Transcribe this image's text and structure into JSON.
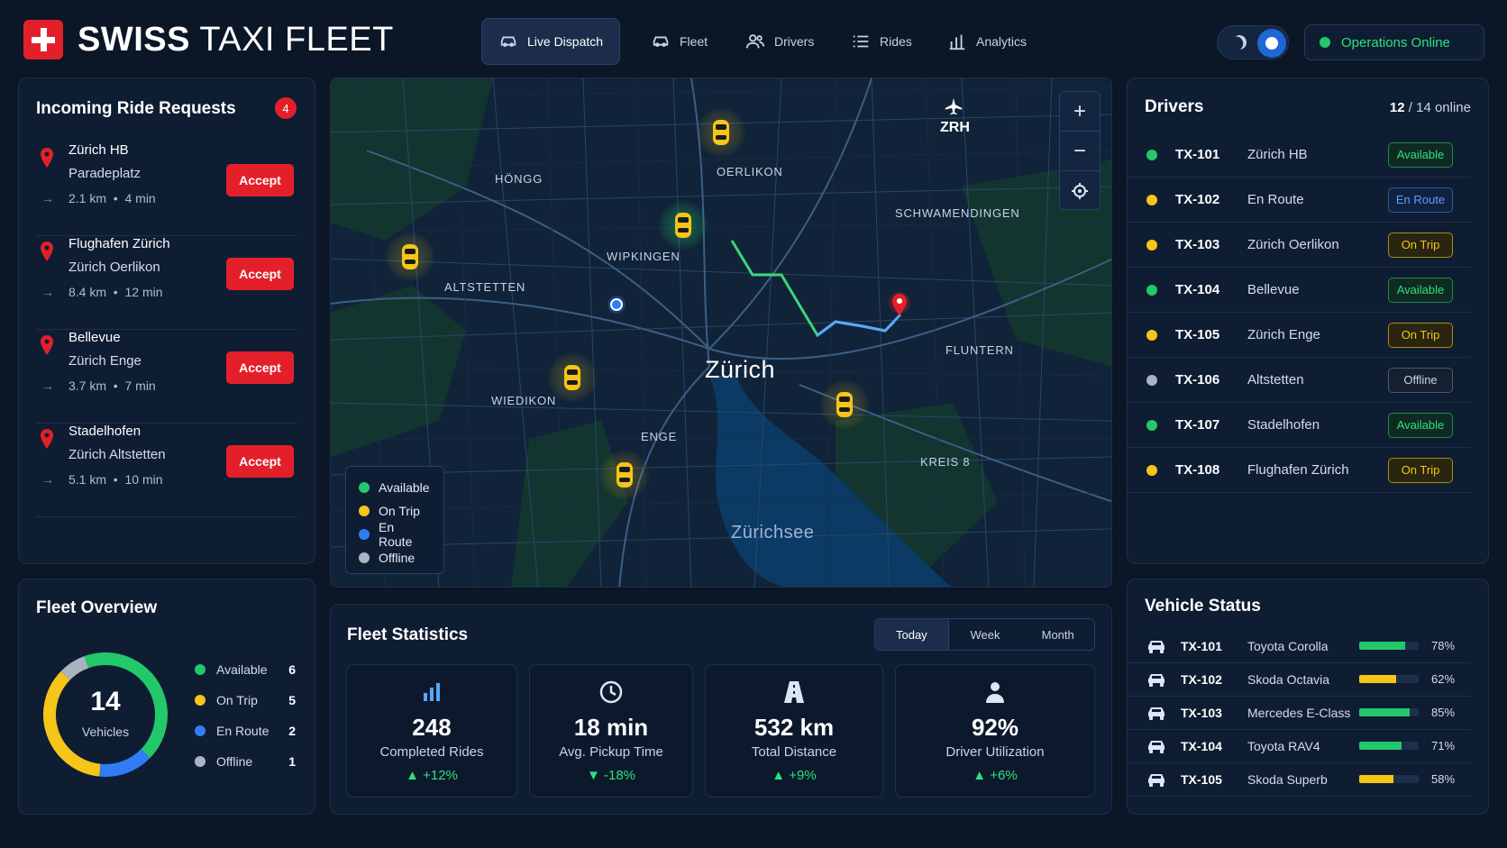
{
  "app": {
    "title_bold": "SWISS",
    "title_rest": "TAXI FLEET"
  },
  "nav": [
    {
      "label": "Live Dispatch",
      "icon": "car-icon"
    },
    {
      "label": "Fleet",
      "icon": "car-icon"
    },
    {
      "label": "Drivers",
      "icon": "users-icon"
    },
    {
      "label": "Rides",
      "icon": "list-icon"
    },
    {
      "label": "Analytics",
      "icon": "bar-chart-icon"
    }
  ],
  "header": {
    "status": "Operations Online",
    "theme": "dark"
  },
  "requests": {
    "title": "Incoming Ride Requests",
    "count": "4",
    "items": [
      {
        "from": "Zürich HB",
        "to": "Paradeplatz",
        "distance": "2.1 km",
        "eta": "4 min",
        "action": "Accept"
      },
      {
        "from": "Flughafen Zürich",
        "to": "Zürich Oerlikon",
        "distance": "8.4 km",
        "eta": "12 min",
        "action": "Accept"
      },
      {
        "from": "Bellevue",
        "to": "Zürich Enge",
        "distance": "3.7 km",
        "eta": "7 min",
        "action": "Accept"
      },
      {
        "from": "Stadelhofen",
        "to": "Zürich Altstetten",
        "distance": "5.1 km",
        "eta": "10 min",
        "action": "Accept"
      }
    ]
  },
  "overview": {
    "title": "Fleet Overview",
    "total": "14",
    "total_label": "Vehicles",
    "items": [
      {
        "label": "Available",
        "count": "6",
        "color": "#22c86a"
      },
      {
        "label": "On Trip",
        "count": "5",
        "color": "#f5c518"
      },
      {
        "label": "En Route",
        "count": "2",
        "color": "#2f7df6"
      },
      {
        "label": "Offline",
        "count": "1",
        "color": "#a9b3c2"
      }
    ]
  },
  "map": {
    "city": "Zürich",
    "lake": "Zürichsee",
    "airport": "ZRH",
    "districts": [
      "HÖNGG",
      "OERLIKON",
      "SCHWAMENDINGEN",
      "WIPKINGEN",
      "ALTSTETTEN",
      "FLUNTERN",
      "WIEDIKON",
      "ENGE",
      "KREIS 8"
    ],
    "legend": [
      "Available",
      "On Trip",
      "En Route",
      "Offline"
    ],
    "zoom_in": "+",
    "zoom_out": "−"
  },
  "stats": {
    "title": "Fleet Statistics",
    "tabs": [
      "Today",
      "Week",
      "Month"
    ],
    "active_tab": "Today",
    "cards": [
      {
        "value": "248",
        "label": "Completed Rides",
        "delta": "▲ +12%",
        "icon": "bar-chart-icon"
      },
      {
        "value": "18 min",
        "label": "Avg. Pickup Time",
        "delta": "▼ -18%",
        "icon": "clock-icon"
      },
      {
        "value": "532 km",
        "label": "Total Distance",
        "delta": "▲ +9%",
        "icon": "road-icon"
      },
      {
        "value": "92%",
        "label": "Driver Utilization",
        "delta": "▲ +6%",
        "icon": "person-icon"
      }
    ]
  },
  "drivers": {
    "title": "Drivers",
    "online_count": "12",
    "online_total": "/ 14 online",
    "items": [
      {
        "id": "TX-101",
        "location": "Zürich HB",
        "status": "Available"
      },
      {
        "id": "TX-102",
        "location": "En Route",
        "status": "En Route"
      },
      {
        "id": "TX-103",
        "location": "Zürich Oerlikon",
        "status": "On Trip"
      },
      {
        "id": "TX-104",
        "location": "Bellevue",
        "status": "Available"
      },
      {
        "id": "TX-105",
        "location": "Zürich Enge",
        "status": "On Trip"
      },
      {
        "id": "TX-106",
        "location": "Altstetten",
        "status": "Offline"
      },
      {
        "id": "TX-107",
        "location": "Stadelhofen",
        "status": "Available"
      },
      {
        "id": "TX-108",
        "location": "Flughafen Zürich",
        "status": "On Trip"
      }
    ]
  },
  "vehicles": {
    "title": "Vehicle Status",
    "items": [
      {
        "id": "TX-101",
        "model": "Toyota Corolla",
        "level": 78,
        "level_label": "78%",
        "color": "#22c86a"
      },
      {
        "id": "TX-102",
        "model": "Skoda Octavia",
        "level": 62,
        "level_label": "62%",
        "color": "#f5c518"
      },
      {
        "id": "TX-103",
        "model": "Mercedes E-Class",
        "level": 85,
        "level_label": "85%",
        "color": "#22c86a"
      },
      {
        "id": "TX-104",
        "model": "Toyota RAV4",
        "level": 71,
        "level_label": "71%",
        "color": "#22c86a"
      },
      {
        "id": "TX-105",
        "model": "Skoda Superb",
        "level": 58,
        "level_label": "58%",
        "color": "#f5c518"
      }
    ]
  },
  "colors": {
    "accent": "#e3202a",
    "available": "#22c86a",
    "on_trip": "#f5c518",
    "en_route": "#2f7df6",
    "offline": "#a9b3c2"
  }
}
